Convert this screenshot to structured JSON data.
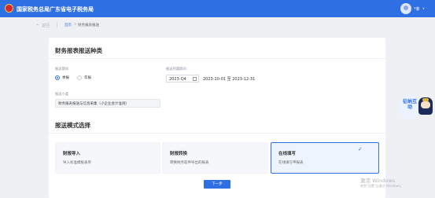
{
  "header": {
    "title": "国家税务总局广东省电子税务局",
    "user_name": "*菲",
    "user_caret": "∨"
  },
  "breadcrumb": {
    "back_icon": "←",
    "back_label": "返回",
    "home": "首页",
    "separator": ">",
    "current": "财务报表报送"
  },
  "report_type": {
    "title": "财务报表报送种类",
    "period_label": "报送期间",
    "period_options": [
      {
        "label": "季报",
        "checked": true
      },
      {
        "label": "年报",
        "checked": false
      }
    ],
    "belong_label": "报送所属期间",
    "belong_value": "2023-Q4",
    "date_range": "2023-10-01 至 2023-12-31",
    "subcategory_label": "报送小类",
    "subcategory_value": "财务报表报送与信息采集（小企业会计准则）"
  },
  "mode": {
    "title": "报送模式选择",
    "options": [
      {
        "title": "财报导入",
        "desc": "导入标准模板表单",
        "active": false
      },
      {
        "title": "财报转换",
        "desc": "转换财务软件导出的报表",
        "active": false
      },
      {
        "title": "在线填写",
        "desc": "在线填写申报表",
        "active": true
      }
    ],
    "check_icon": "✓"
  },
  "next_button": "下一步",
  "assistant": {
    "text": "征纳互动",
    "icon": "robot-assistant-icon"
  },
  "watermark": {
    "line1": "激活 Windows",
    "line2": "转到\"设置\"以激活 Windows。"
  },
  "colors": {
    "primary": "#2f6fe4",
    "background": "#eef0f4"
  }
}
